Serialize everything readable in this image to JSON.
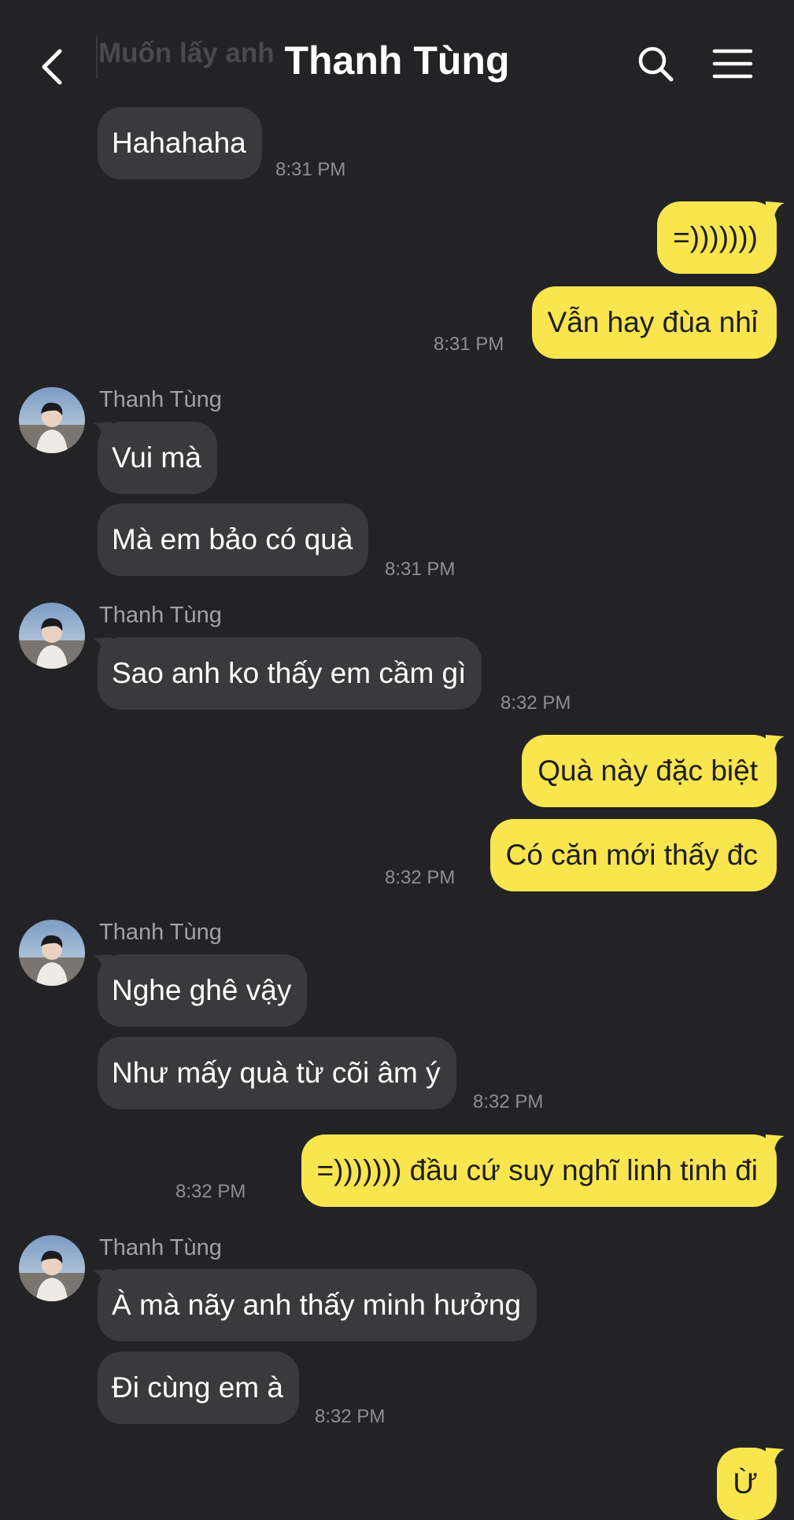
{
  "header": {
    "title": "Thanh Tùng",
    "ghost_text": "Muốn lấy anh"
  },
  "colors": {
    "background": "#232325",
    "incoming_bubble": "#3a3a3c",
    "outgoing_bubble": "#f9e54e",
    "time_text": "#8e8e93"
  },
  "messages": [
    {
      "dir": "in",
      "text": "Hahahaha",
      "time": "8:31 PM"
    },
    {
      "dir": "out",
      "text": "=)))))))"
    },
    {
      "dir": "out",
      "text": "Vẫn hay đùa nhỉ",
      "time": "8:31 PM"
    },
    {
      "dir": "in",
      "sender": "Thanh Tùng",
      "text": "Vui mà"
    },
    {
      "dir": "in",
      "text": "Mà em bảo có quà",
      "time": "8:31 PM"
    },
    {
      "dir": "in",
      "sender": "Thanh Tùng",
      "text": "Sao anh ko thấy em cầm gì",
      "time": "8:32 PM"
    },
    {
      "dir": "out",
      "text": "Quà này đặc biệt"
    },
    {
      "dir": "out",
      "text": "Có căn mới thấy đc",
      "time": "8:32 PM"
    },
    {
      "dir": "in",
      "sender": "Thanh Tùng",
      "text": "Nghe ghê vậy"
    },
    {
      "dir": "in",
      "text": "Như mấy quà từ cõi âm ý",
      "time": "8:32 PM"
    },
    {
      "dir": "out",
      "text": "=))))))) đầu cứ suy nghĩ linh tinh đi",
      "time": "8:32 PM"
    },
    {
      "dir": "in",
      "sender": "Thanh Tùng",
      "text": "À mà nãy anh thấy minh hưởng"
    },
    {
      "dir": "in",
      "text": "Đi cùng em à",
      "time": "8:32 PM"
    },
    {
      "dir": "out",
      "text": "Ừ"
    }
  ]
}
